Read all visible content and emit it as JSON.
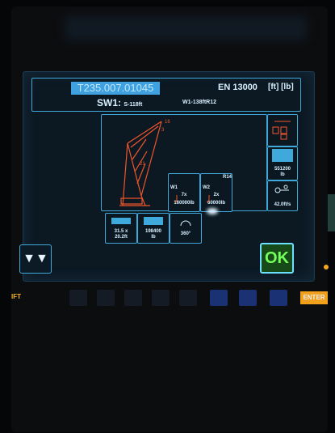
{
  "header": {
    "config_code": "T235.007.01045",
    "norm": "EN 13000",
    "units": "[ft]  [lb]",
    "sw_label": "SW1:",
    "sw_value": "S-118ft",
    "sw_right": "W1-138ftR12"
  },
  "boom_diagram": {
    "tip_labels": [
      "16",
      "3"
    ],
    "mid_label": "21"
  },
  "winch_tiles": [
    {
      "label": "W1",
      "reeving": "7x",
      "load": "160000lb"
    },
    {
      "label": "W2",
      "reeving": "2x",
      "load": "60000lb",
      "top_label": "R14"
    }
  ],
  "bottom_tiles": [
    {
      "value_line1": "31.5 x",
      "value_line2": "20.2ft"
    },
    {
      "value_line1": "198400",
      "value_line2": "lb"
    },
    {
      "value_line1": "360°",
      "value_line2": ""
    }
  ],
  "right_tiles": [
    {
      "value": "551200",
      "value2": "lb"
    },
    {
      "value": "42.0ft/s"
    }
  ],
  "buttons": {
    "down_label": "▼▼",
    "ok_label": "OK"
  },
  "keyboard": {
    "shift_label": "IFT",
    "enter_label": "ENTER"
  },
  "colors": {
    "accent_blue": "#3fa9dc",
    "crane_red": "#f0552b",
    "ok_green": "#74ff5c",
    "highlight_blue": "#3fa1e0"
  }
}
